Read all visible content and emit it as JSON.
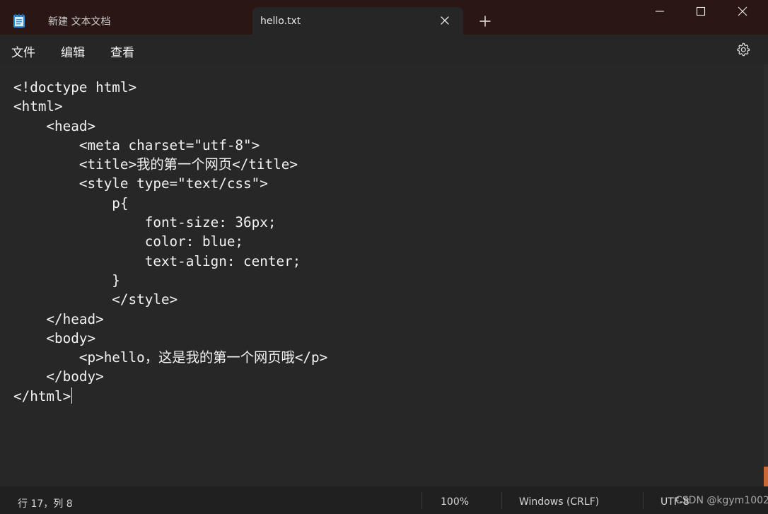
{
  "window": {
    "tabs": [
      {
        "label": "新建 文本文档",
        "active": false
      },
      {
        "label": "hello.txt",
        "active": true
      }
    ],
    "icons": {
      "app": "notepad-icon",
      "close_tab": "close-icon",
      "new_tab": "plus-icon",
      "minimize": "minimize-icon",
      "maximize": "maximize-icon",
      "close_window": "close-icon",
      "settings": "gear-icon"
    }
  },
  "menu": {
    "file": "文件",
    "edit": "编辑",
    "view": "查看"
  },
  "editor": {
    "lines": [
      "<!doctype html>",
      "<html>",
      "    <head>",
      "        <meta charset=\"utf-8\">",
      "        <title>我的第一个网页</title>",
      "        <style type=\"text/css\">",
      "            p{",
      "                font-size: 36px;",
      "                color: blue;",
      "                text-align: center;",
      "            }",
      "            </style>",
      "    </head>",
      "    <body>",
      "        <p>hello，这是我的第一个网页哦</p>",
      "    </body>",
      "</html>"
    ]
  },
  "status": {
    "position": "行 17，列 8",
    "zoom": "100%",
    "line_ending": "Windows (CRLF)",
    "encoding": "UTF-8"
  },
  "watermark": "CSDN @kgym1002",
  "colors": {
    "titlebar": "#2a1714",
    "editor_bg": "#272727",
    "statusbar": "#202020",
    "text": "#f2f2f2"
  }
}
